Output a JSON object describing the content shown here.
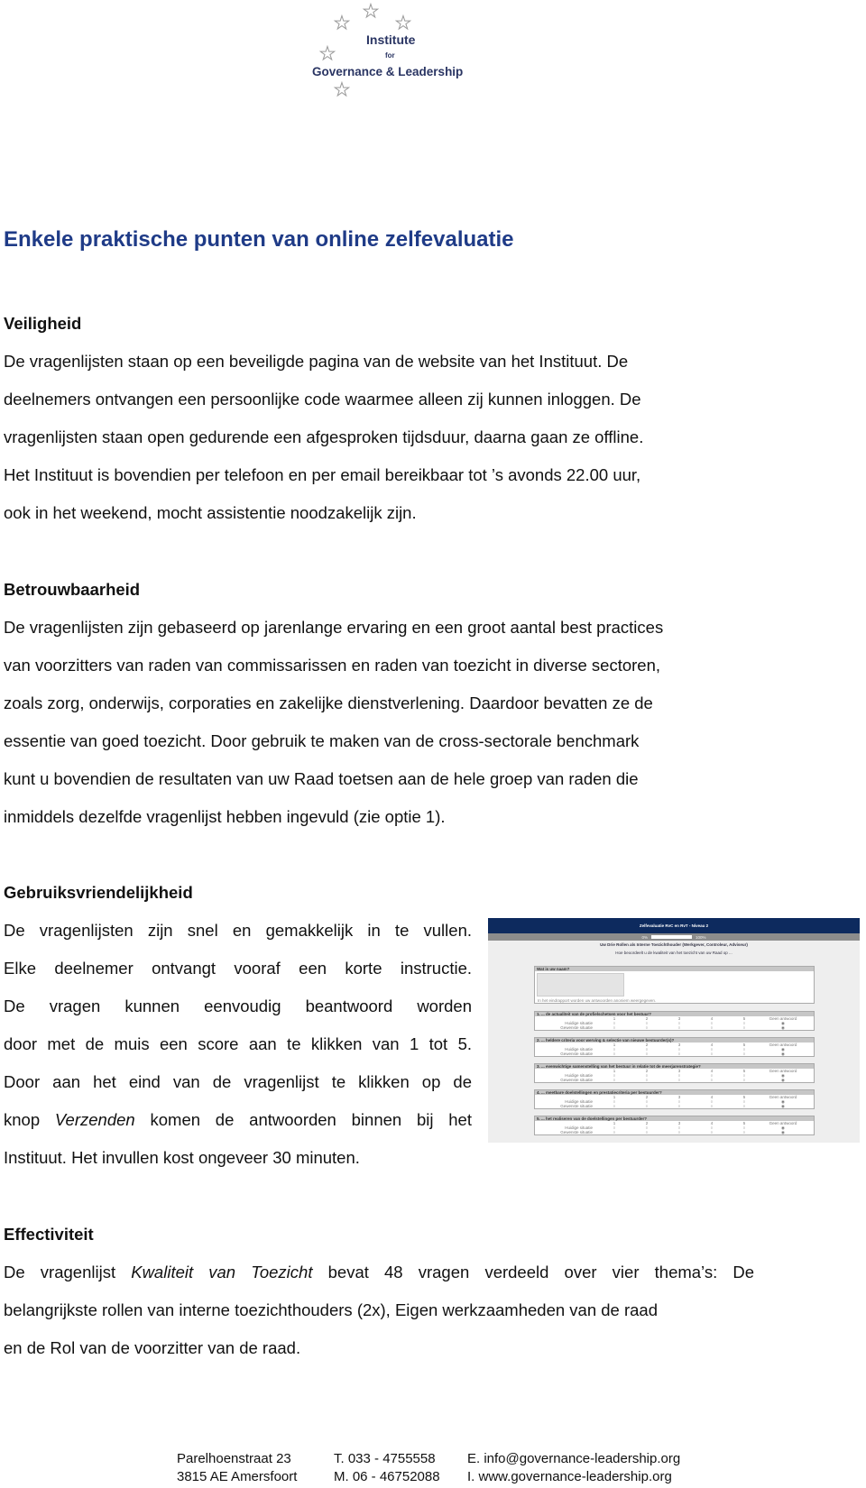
{
  "logo": {
    "line1": "Institute",
    "line2": "for",
    "line3": "Governance & Leadership"
  },
  "title": "Enkele praktische punten van online zelfevaluatie",
  "sections": {
    "veiligheid": {
      "heading": "Veiligheid",
      "lines": [
        "De vragenlijsten staan op een beveiligde pagina van de website van het Instituut. De",
        "deelnemers ontvangen een persoonlijke code waarmee alleen zij kunnen inloggen. De",
        "vragenlijsten staan open gedurende een afgesproken tijdsduur, daarna gaan ze offline.",
        "Het Instituut is bovendien per telefoon en per email bereikbaar tot ’s avonds 22.00 uur,",
        "ook in het weekend, mocht assistentie noodzakelijk zijn."
      ]
    },
    "betrouwbaarheid": {
      "heading": "Betrouwbaarheid",
      "lines": [
        "De vragenlijsten zijn gebaseerd op jarenlange ervaring en een groot aantal best practices",
        "van voorzitters van raden van commissarissen en raden van toezicht in diverse sectoren,",
        "zoals zorg, onderwijs, corporaties en zakelijke dienstverlening. Daardoor bevatten ze de",
        "essentie van goed toezicht. Door gebruik te maken van de cross-sectorale benchmark",
        "kunt u bovendien de resultaten van uw Raad toetsen aan de hele groep van raden die",
        "inmiddels dezelfde vragenlijst hebben ingevuld (zie optie 1)."
      ]
    },
    "gebruiksvriendelijkheid": {
      "heading": "Gebruiksvriendelijkheid",
      "lines": [
        "De vragenlijsten zijn snel en gemakkelijk in te vullen.",
        "Elke deelnemer ontvangt vooraf een korte instructie.",
        "De vragen kunnen eenvoudig beantwoord worden",
        "door met de muis een score aan te klikken van 1 tot 5.",
        "Door aan het eind van de vragenlijst te klikken op de"
      ],
      "line6_pre": "knop ",
      "line6_italic": "Verzenden",
      "line6_post": " komen de antwoorden binnen bij het",
      "line7": "Instituut. Het invullen kost ongeveer 30 minuten."
    },
    "effectiviteit": {
      "heading": "Effectiviteit",
      "line1_pre": "De vragenlijst ",
      "line1_italic": "Kwaliteit van Toezicht",
      "line1_post": " bevat 48 vragen verdeeld over vier thema’s: De",
      "line2": "belangrijkste rollen van interne toezichthouders (2x), Eigen werkzaamheden van de raad",
      "line3": "en de Rol van de voorzitter van de raad."
    }
  },
  "screenshot": {
    "header": "Zelfevaluatie RvC en RvT - Niveau 2",
    "progress_start": "0%",
    "progress_end": "100%",
    "progress_value": 0,
    "subtitle": "Uw Drie Rollen als Interne Toezichthouder (Werkgever, Controleur, Adviseur)",
    "question_intro": "Hoe beoordeelt u de kwaliteit van het toezicht van uw Raad op ...",
    "name_label": "Wat is uw naam?",
    "name_note": "In het eindrapport worden uw antwoorden anoniem weergegeven.",
    "scale": [
      "1",
      "2",
      "3",
      "4",
      "5",
      "Geen antwoord"
    ],
    "row_current": "Huidige situatie",
    "row_desired": "Gewenste situatie",
    "questions": [
      "1. ... de actualiteit van de profielschetsen voor het bestuur?",
      "2. ... heldere criteria voor werving & selectie van nieuwe bestuurder(s)?",
      "3. ... evenwichtige samenstelling van het bestuur in relatie tot de meerjarenstrategie?",
      "4. ... meetbare doelstellingen en prestatiecriteria per bestuurder?",
      "5. ... het realiseren van de doelstellingen per bestuurder?"
    ],
    "colors": {
      "header": "#0d2a5e",
      "progress": "#8c8c8c"
    }
  },
  "footer": {
    "address1": "Parelhoenstraat 23",
    "address2": "3815 AE Amersfoort",
    "phone": "T.  033 - 4755558",
    "mobile": "M.  06 - 46752088",
    "email": "E. info@governance-leadership.org",
    "web": "I.  www.governance-leadership.org"
  },
  "colors": {
    "title": "#1f3b87",
    "logo_text": "#2a3563"
  }
}
